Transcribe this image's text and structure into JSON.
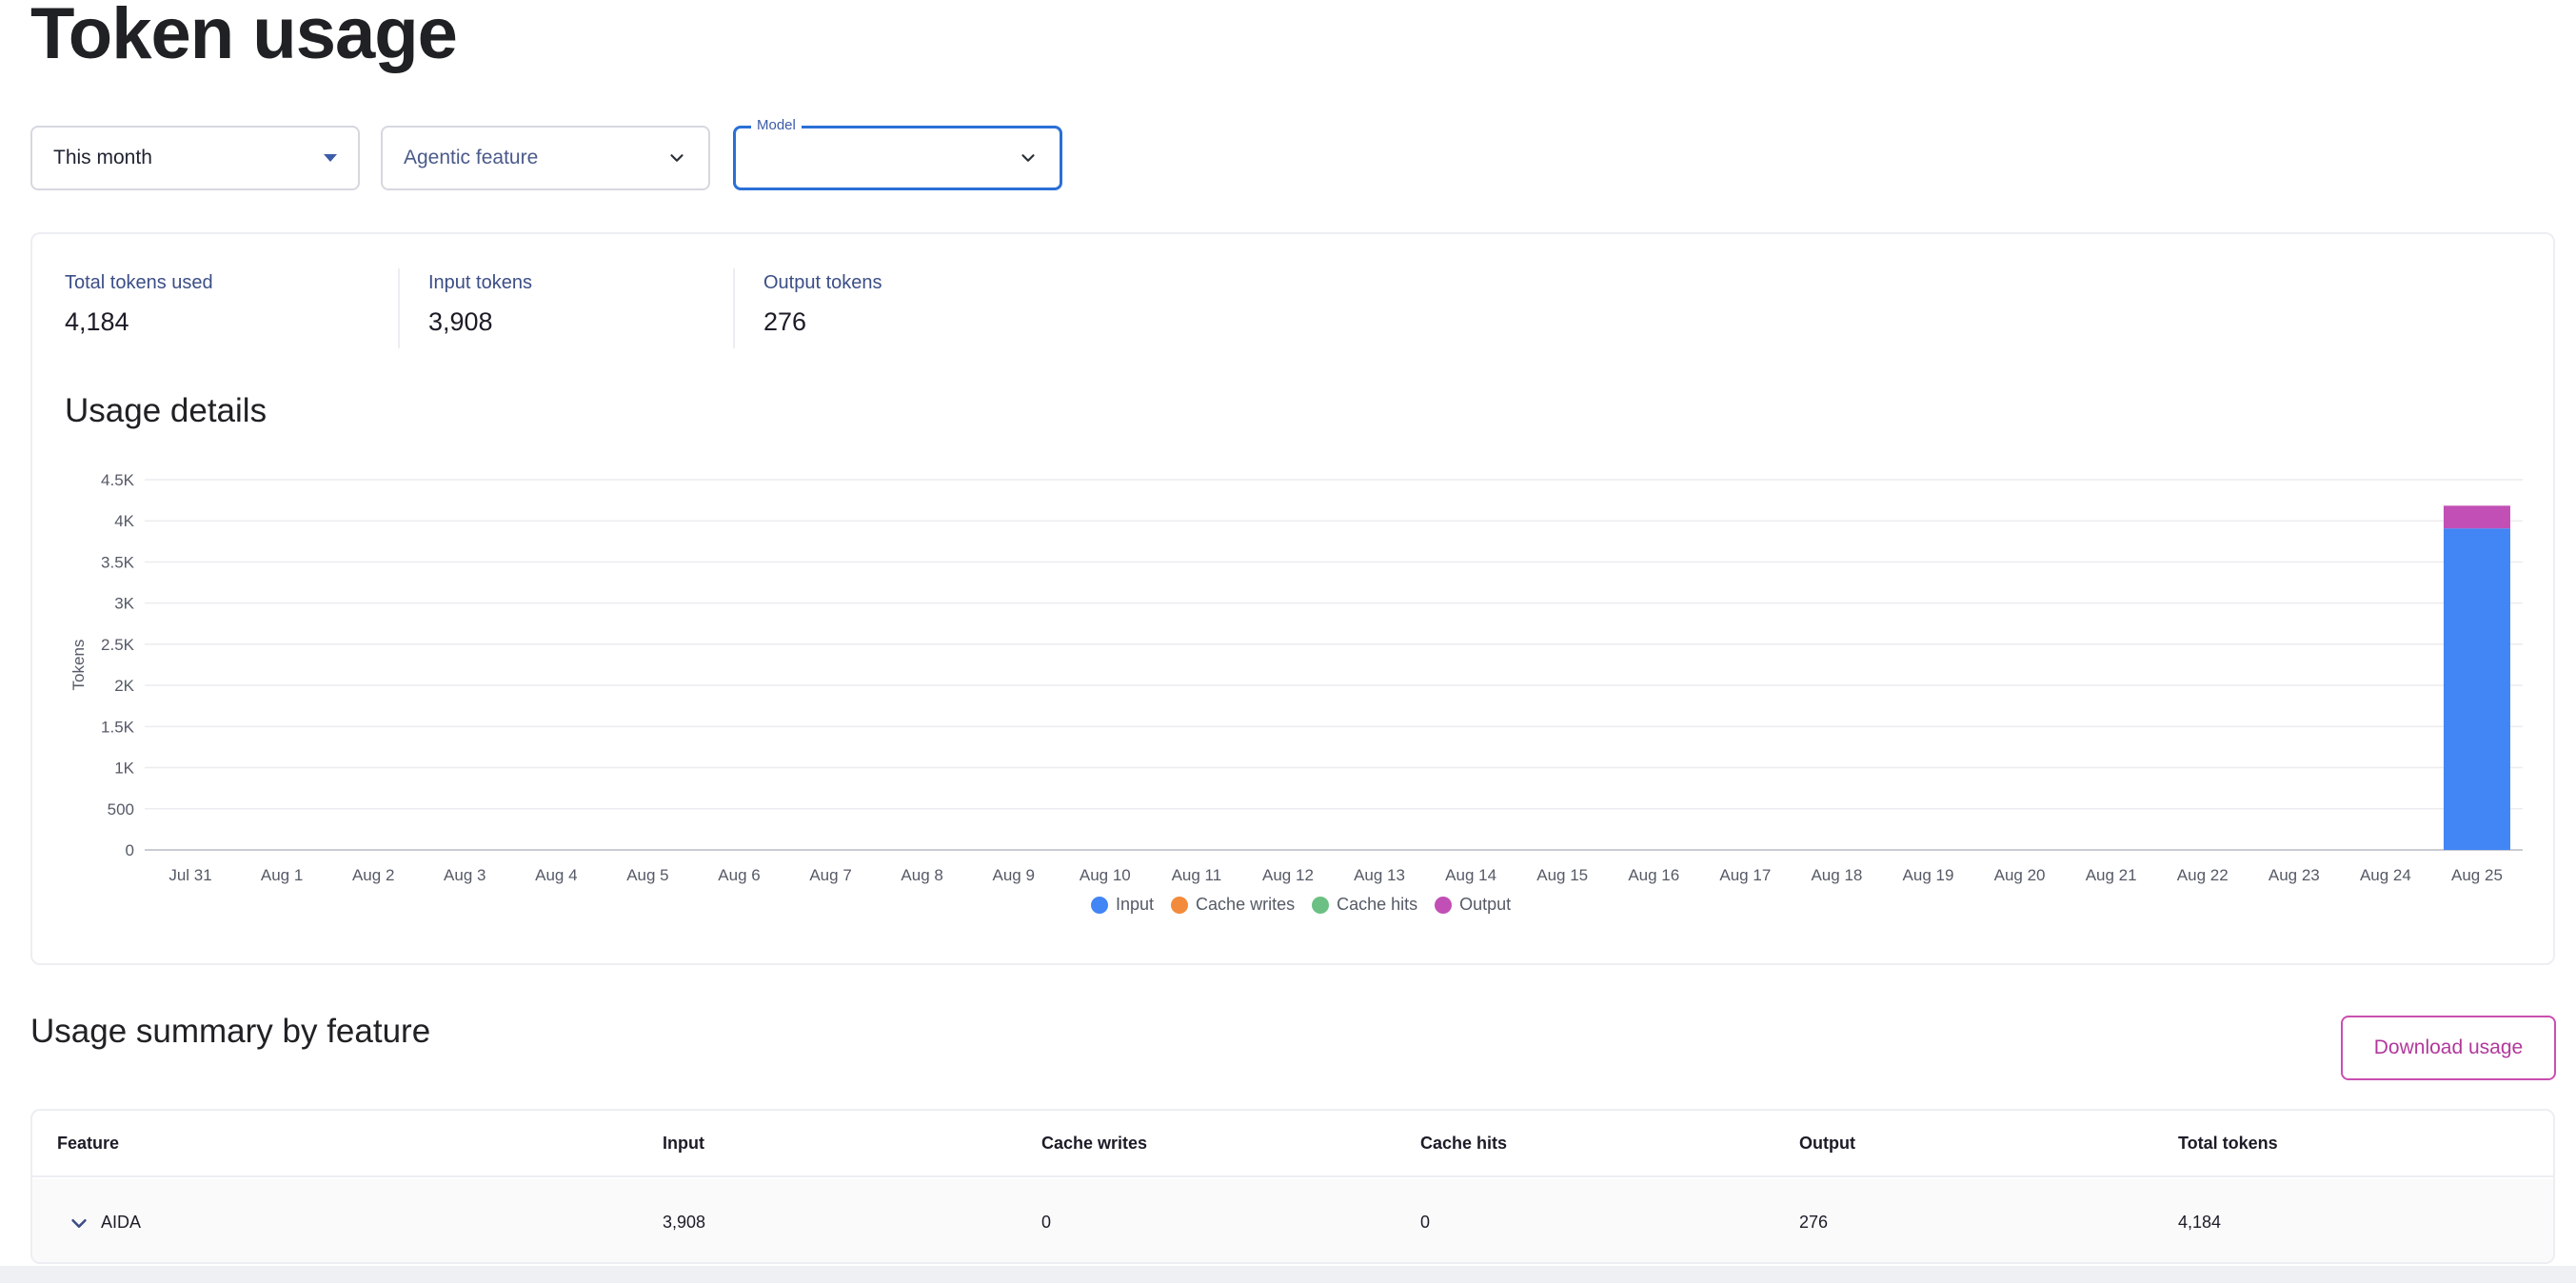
{
  "page": {
    "title": "Token usage"
  },
  "filters": {
    "period": {
      "value": "This month"
    },
    "feature": {
      "placeholder": "Agentic feature"
    },
    "model": {
      "label": "Model",
      "value": ""
    }
  },
  "stats": [
    {
      "label": "Total tokens used",
      "value": "4,184"
    },
    {
      "label": "Input tokens",
      "value": "3,908"
    },
    {
      "label": "Output tokens",
      "value": "276"
    }
  ],
  "usage_details": {
    "title": "Usage details"
  },
  "chart_data": {
    "type": "bar",
    "stacked": true,
    "ylabel": "Tokens",
    "ylim": [
      0,
      4500
    ],
    "yticks": [
      "0",
      "500",
      "1K",
      "1.5K",
      "2K",
      "2.5K",
      "3K",
      "3.5K",
      "4K",
      "4.5K"
    ],
    "categories": [
      "Jul 31",
      "Aug 1",
      "Aug 2",
      "Aug 3",
      "Aug 4",
      "Aug 5",
      "Aug 6",
      "Aug 7",
      "Aug 8",
      "Aug 9",
      "Aug 10",
      "Aug 11",
      "Aug 12",
      "Aug 13",
      "Aug 14",
      "Aug 15",
      "Aug 16",
      "Aug 17",
      "Aug 18",
      "Aug 19",
      "Aug 20",
      "Aug 21",
      "Aug 22",
      "Aug 23",
      "Aug 24",
      "Aug 25"
    ],
    "series": [
      {
        "name": "Input",
        "color": "#4285f4",
        "values": [
          0,
          0,
          0,
          0,
          0,
          0,
          0,
          0,
          0,
          0,
          0,
          0,
          0,
          0,
          0,
          0,
          0,
          0,
          0,
          0,
          0,
          0,
          0,
          0,
          0,
          3908
        ]
      },
      {
        "name": "Cache writes",
        "color": "#f28b3b",
        "values": [
          0,
          0,
          0,
          0,
          0,
          0,
          0,
          0,
          0,
          0,
          0,
          0,
          0,
          0,
          0,
          0,
          0,
          0,
          0,
          0,
          0,
          0,
          0,
          0,
          0,
          0
        ]
      },
      {
        "name": "Cache hits",
        "color": "#6cc083",
        "values": [
          0,
          0,
          0,
          0,
          0,
          0,
          0,
          0,
          0,
          0,
          0,
          0,
          0,
          0,
          0,
          0,
          0,
          0,
          0,
          0,
          0,
          0,
          0,
          0,
          0,
          0
        ]
      },
      {
        "name": "Output",
        "color": "#c14fb5",
        "values": [
          0,
          0,
          0,
          0,
          0,
          0,
          0,
          0,
          0,
          0,
          0,
          0,
          0,
          0,
          0,
          0,
          0,
          0,
          0,
          0,
          0,
          0,
          0,
          0,
          0,
          276
        ]
      }
    ],
    "grid": true,
    "legend_position": "bottom"
  },
  "summary": {
    "title": "Usage summary by feature",
    "download_label": "Download usage",
    "columns": [
      "Feature",
      "Input",
      "Cache writes",
      "Cache hits",
      "Output",
      "Total tokens"
    ],
    "rows": [
      {
        "cells": [
          "AIDA",
          "3,908",
          "0",
          "0",
          "276",
          "4,184"
        ]
      }
    ]
  }
}
